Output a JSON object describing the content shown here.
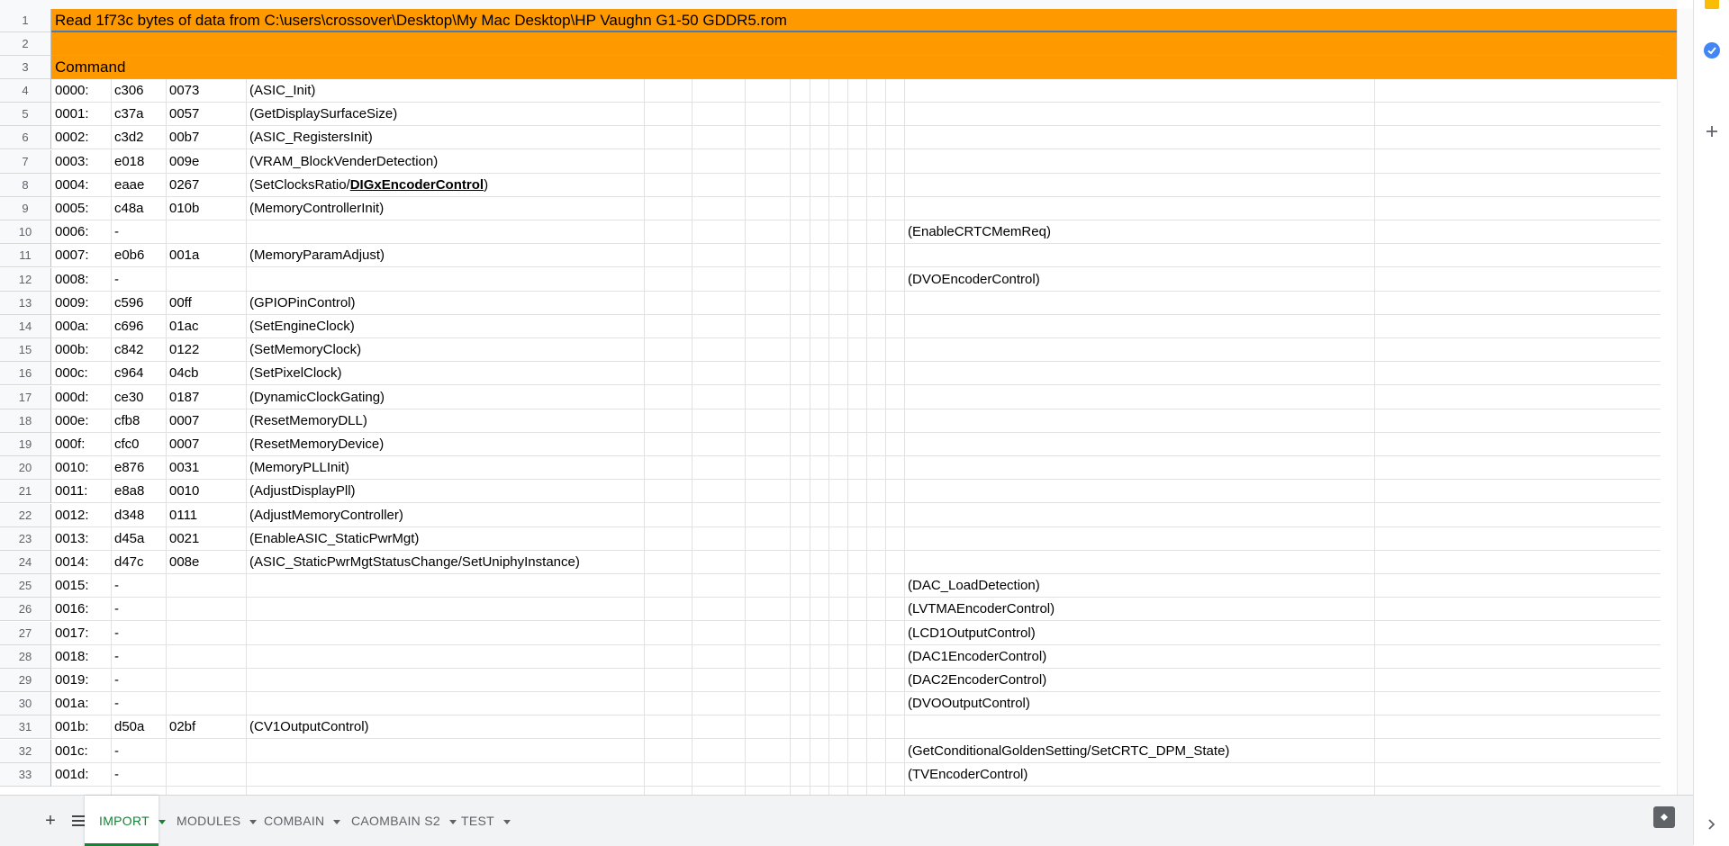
{
  "sheet": {
    "title_row": "Read 1f73c bytes of data from C:\\users\\crossover\\Desktop\\My Mac Desktop\\HP Vaughn G1-50 GDDR5.rom",
    "header_label": "Command",
    "colors": {
      "header_bg": "#ff9900",
      "active_tab": "#188038"
    },
    "rows": [
      {
        "num": "4",
        "a": "0000:",
        "b": "c306",
        "c": "0073",
        "d": "(ASIC_Init)",
        "h": ""
      },
      {
        "num": "5",
        "a": "0001:",
        "b": "c37a",
        "c": "0057",
        "d": "(GetDisplaySurfaceSize)",
        "h": ""
      },
      {
        "num": "6",
        "a": "0002:",
        "b": "c3d2",
        "c": "00b7",
        "d": "(ASIC_RegistersInit)",
        "h": ""
      },
      {
        "num": "7",
        "a": "0003:",
        "b": "e018",
        "c": "009e",
        "d": "(VRAM_BlockVenderDetection)",
        "h": ""
      },
      {
        "num": "8",
        "a": "0004:",
        "b": "eaae",
        "c": "0267",
        "d": "",
        "h": ""
      },
      {
        "num": "9",
        "a": "0005:",
        "b": "c48a",
        "c": "010b",
        "d": "(MemoryControllerInit)",
        "h": ""
      },
      {
        "num": "10",
        "a": "0006:",
        "b": "-",
        "c": "",
        "d": "",
        "h": "(EnableCRTCMemReq)"
      },
      {
        "num": "11",
        "a": "0007:",
        "b": "e0b6",
        "c": "001a",
        "d": "(MemoryParamAdjust)",
        "h": ""
      },
      {
        "num": "12",
        "a": "0008:",
        "b": "-",
        "c": "",
        "d": "",
        "h": "(DVOEncoderControl)"
      },
      {
        "num": "13",
        "a": "0009:",
        "b": "c596",
        "c": "00ff",
        "d": "(GPIOPinControl)",
        "h": ""
      },
      {
        "num": "14",
        "a": "000a:",
        "b": "c696",
        "c": "01ac",
        "d": "(SetEngineClock)",
        "h": ""
      },
      {
        "num": "15",
        "a": "000b:",
        "b": "c842",
        "c": "0122",
        "d": "(SetMemoryClock)",
        "h": ""
      },
      {
        "num": "16",
        "a": "000c:",
        "b": "c964",
        "c": "04cb",
        "d": "(SetPixelClock)",
        "h": ""
      },
      {
        "num": "17",
        "a": "000d:",
        "b": "ce30",
        "c": "0187",
        "d": "(DynamicClockGating)",
        "h": ""
      },
      {
        "num": "18",
        "a": "000e:",
        "b": "cfb8",
        "c": "0007",
        "d": "(ResetMemoryDLL)",
        "h": ""
      },
      {
        "num": "19",
        "a": "000f:",
        "b": "cfc0",
        "c": "0007",
        "d": "(ResetMemoryDevice)",
        "h": ""
      },
      {
        "num": "20",
        "a": "0010:",
        "b": "e876",
        "c": "0031",
        "d": "(MemoryPLLInit)",
        "h": ""
      },
      {
        "num": "21",
        "a": "0011:",
        "b": "e8a8",
        "c": "0010",
        "d": "(AdjustDisplayPll)",
        "h": ""
      },
      {
        "num": "22",
        "a": "0012:",
        "b": "d348",
        "c": "0111",
        "d": "(AdjustMemoryController)",
        "h": ""
      },
      {
        "num": "23",
        "a": "0013:",
        "b": "d45a",
        "c": "0021",
        "d": "(EnableASIC_StaticPwrMgt)",
        "h": ""
      },
      {
        "num": "24",
        "a": "0014:",
        "b": "d47c",
        "c": "008e",
        "d": "(ASIC_StaticPwrMgtStatusChange/SetUniphyInstance)",
        "h": ""
      },
      {
        "num": "25",
        "a": "0015:",
        "b": "-",
        "c": "",
        "d": "",
        "h": "(DAC_LoadDetection)"
      },
      {
        "num": "26",
        "a": "0016:",
        "b": "-",
        "c": "",
        "d": "",
        "h": "(LVTMAEncoderControl)"
      },
      {
        "num": "27",
        "a": "0017:",
        "b": "-",
        "c": "",
        "d": "",
        "h": "(LCD1OutputControl)"
      },
      {
        "num": "28",
        "a": "0018:",
        "b": "-",
        "c": "",
        "d": "",
        "h": "(DAC1EncoderControl)"
      },
      {
        "num": "29",
        "a": "0019:",
        "b": "-",
        "c": "",
        "d": "",
        "h": "(DAC2EncoderControl)"
      },
      {
        "num": "30",
        "a": "001a:",
        "b": "-",
        "c": "",
        "d": "",
        "h": "(DVOOutputControl)"
      },
      {
        "num": "31",
        "a": "001b:",
        "b": "d50a",
        "c": "02bf",
        "d": "(CV1OutputControl)",
        "h": ""
      },
      {
        "num": "32",
        "a": "001c:",
        "b": "-",
        "c": "",
        "d": "",
        "h": "(GetConditionalGoldenSetting/SetCRTC_DPM_State)"
      },
      {
        "num": "33",
        "a": "001d:",
        "b": "-",
        "c": "",
        "d": "",
        "h": "(TVEncoderControl)"
      }
    ],
    "row8_parts": {
      "pre": "(SetClocksRatio/",
      "link": "DIGxEncoderControl",
      "post": ")"
    },
    "row_numbers": {
      "r1": "1",
      "r2": "2",
      "r3": "3"
    }
  },
  "tabs": {
    "add_icon": "plus-icon",
    "list_icon": "list-icon",
    "items": [
      {
        "label": "IMPORT",
        "active": true
      },
      {
        "label": "MODULES",
        "active": false
      },
      {
        "label": "COMBAIN",
        "active": false
      },
      {
        "label": "CAOMBAIN S2",
        "active": false
      },
      {
        "label": "TEST",
        "active": false
      }
    ]
  },
  "side_panel": {
    "icons": [
      "keep-icon",
      "tasks-icon",
      "add-addon-icon",
      "expand-icon"
    ]
  }
}
